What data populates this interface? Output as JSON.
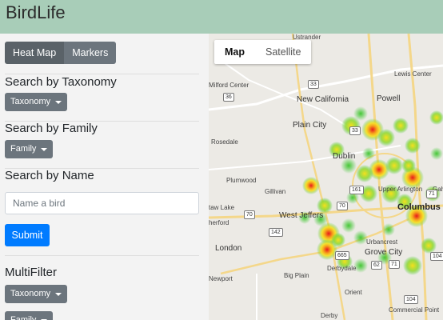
{
  "header": {
    "brand": "BirdLife"
  },
  "sidebar": {
    "view_toggle": {
      "heat_map": "Heat Map",
      "markers": "Markers"
    },
    "taxonomy_section": {
      "title": "Search by Taxonomy",
      "dropdown": "Taxonomy"
    },
    "family_section": {
      "title": "Search by Family",
      "dropdown": "Family"
    },
    "name_section": {
      "title": "Search by Name",
      "placeholder": "Name a bird",
      "submit": "Submit"
    },
    "multifilter_section": {
      "title": "MultiFilter",
      "taxonomy_dropdown": "Taxonomy",
      "family_dropdown": "Family"
    }
  },
  "map": {
    "type_toggle": {
      "map": "Map",
      "satellite": "Satellite",
      "selected": "Map"
    },
    "places": {
      "ustrander": "Ustrander",
      "lewis_center": "Lewis Center",
      "milford_center": "Milford Center",
      "new_california": "New California",
      "powell": "Powell",
      "plain_city": "Plain City",
      "rosedale": "Rosedale",
      "dublin": "Dublin",
      "plumwood": "Plumwood",
      "gillivan": "Gillivan",
      "upper_arlington": "Upper Arlington",
      "columbus": "Columbus",
      "taw_lake": "taw Lake",
      "west_jefferson": "West Jeffers",
      "herford": "herford",
      "london": "London",
      "urbancrest": "Urbancrest",
      "grove_city": "Grove City",
      "newport": "Newport",
      "big_plain": "Big Plain",
      "derbydale": "Derbydale",
      "orient": "Orient",
      "commercial_point": "Commercial Point",
      "derby": "Derby",
      "gahanna": "Gah"
    },
    "shields": [
      "33",
      "36",
      "33",
      "161",
      "70",
      "142",
      "62",
      "104",
      "71",
      "665",
      "104",
      "70",
      "71"
    ],
    "heat_color_hot": "#e8191c",
    "heat_color_mid": "#f6e01c",
    "heat_color_cool": "#3bc52c"
  }
}
